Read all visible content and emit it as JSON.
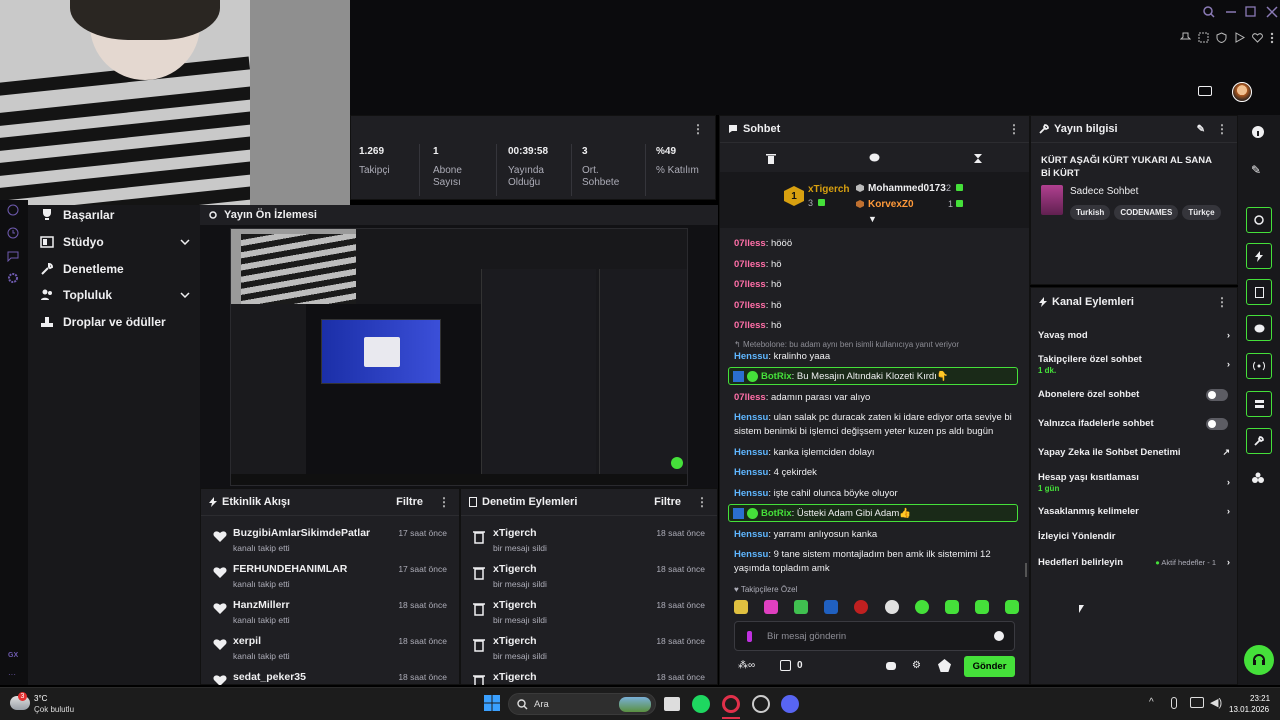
{
  "stats": [
    {
      "value": "1.269",
      "label": "Takipçi"
    },
    {
      "value": "1",
      "label": "Abone Sayısı"
    },
    {
      "value": "00:39:58",
      "label": "Yayında Olduğu"
    },
    {
      "value": "3",
      "label": "Ort. Sohbete"
    },
    {
      "value": "%49",
      "label": "% Katılım"
    }
  ],
  "nav": {
    "items": [
      {
        "label": "Başarılar"
      },
      {
        "label": "Stüdyo"
      },
      {
        "label": "Denetleme"
      },
      {
        "label": "Topluluk"
      },
      {
        "label": "Droplar ve ödüller"
      }
    ],
    "bottom_tag": "GX"
  },
  "preview": {
    "title": "Yayın Ön İzlemesi"
  },
  "activity": {
    "title": "Etkinlik Akışı",
    "filter": "Filtre",
    "rows": [
      {
        "name": "BuzgibiAmlarSikimdePatlar",
        "sub": "kanalı takip etti",
        "time": "17 saat önce"
      },
      {
        "name": "FERHUNDEHANIMLAR",
        "sub": "kanalı takip etti",
        "time": "17 saat önce"
      },
      {
        "name": "HanzMillerr",
        "sub": "kanalı takip etti",
        "time": "18 saat önce"
      },
      {
        "name": "xerpil",
        "sub": "kanalı takip etti",
        "time": "18 saat önce"
      },
      {
        "name": "sedat_peker35",
        "sub": "",
        "time": "18 saat önce"
      }
    ]
  },
  "moderation": {
    "title": "Denetim Eylemleri",
    "filter": "Filtre",
    "rows": [
      {
        "name": "xTigerch",
        "sub": "bir mesajı sildi",
        "time": "18 saat önce"
      },
      {
        "name": "xTigerch",
        "sub": "bir mesajı sildi",
        "time": "18 saat önce"
      },
      {
        "name": "xTigerch",
        "sub": "bir mesajı sildi",
        "time": "18 saat önce"
      },
      {
        "name": "xTigerch",
        "sub": "bir mesajı sildi",
        "time": "18 saat önce"
      },
      {
        "name": "xTigerch",
        "sub": "",
        "time": "18 saat önce"
      }
    ]
  },
  "chat": {
    "title": "Sohbet",
    "leaderboard": {
      "first": {
        "name": "xTigerch",
        "count": "3"
      },
      "others": [
        {
          "name": "Mohammed0173",
          "count": "2"
        },
        {
          "name": "KorvexZ0",
          "count": "1"
        }
      ]
    },
    "reply_note": "Metebolone: bu adam aynı ben isimli kullanıcıya yanıt veriyor",
    "messages": [
      {
        "user": "07lless",
        "text": "hööö",
        "color": "#ff6fa8"
      },
      {
        "user": "07lless",
        "text": "hö",
        "color": "#ff6fa8"
      },
      {
        "user": "07lless",
        "text": "hö",
        "color": "#ff6fa8"
      },
      {
        "user": "07lless",
        "text": "hö",
        "color": "#ff6fa8"
      },
      {
        "user": "07lless",
        "text": "hö",
        "color": "#ff6fa8"
      },
      {
        "user": "Henssu",
        "text": "kralinho yaaa",
        "color": "#5fb6ff"
      },
      {
        "user": "BotRix",
        "text": "Bu Mesajın Altındaki Klozeti Kırdı👇",
        "color": "#45e03a",
        "bot": true
      },
      {
        "user": "07lless",
        "text": "adamın parası var alıyo",
        "color": "#ff6fa8"
      },
      {
        "user": "Henssu",
        "text": "ulan salak pc duracak zaten ki idare ediyor orta seviye bi sistem benimki bi işlemci değişsem yeter kuzen ps aldı bugün",
        "color": "#5fb6ff"
      },
      {
        "user": "Henssu",
        "text": "kanka işlemciden dolayı",
        "color": "#5fb6ff"
      },
      {
        "user": "Henssu",
        "text": "4 çekirdek",
        "color": "#5fb6ff"
      },
      {
        "user": "Henssu",
        "text": "işte cahil olunca böyke oluyor",
        "color": "#5fb6ff"
      },
      {
        "user": "BotRix",
        "text": "Üstteki Adam Gibi Adam👍",
        "color": "#45e03a",
        "bot": true
      },
      {
        "user": "Henssu",
        "text": "yarramı anlıyosun kanka",
        "color": "#5fb6ff"
      },
      {
        "user": "Henssu",
        "text": "9 tane sistem montajladım ben amk ilk sistemimi 12 yaşımda topladım amk",
        "color": "#5fb6ff"
      }
    ],
    "followers_only": "Takipçilere Özel",
    "input_placeholder": "Bir mesaj gönderin",
    "points": "0",
    "send_label": "Gönder"
  },
  "info": {
    "title": "Yayın bilgisi",
    "stream_title": "KÜRT AŞAĞI KÜRT YUKARI AL SANA Bİ KÜRT",
    "category": "Sadece Sohbet",
    "tags": [
      "Turkish",
      "CODENAMES",
      "Türkçe"
    ]
  },
  "actions": {
    "title": "Kanal Eylemleri",
    "items": [
      {
        "label": "Yavaş mod",
        "sub": "",
        "kind": "chev"
      },
      {
        "label": "Takipçilere özel sohbet",
        "sub": "1 dk.",
        "kind": "chev"
      },
      {
        "label": "Abonelere özel sohbet",
        "sub": "",
        "kind": "toggle"
      },
      {
        "label": "Yalnızca ifadelerle sohbet",
        "sub": "",
        "kind": "toggle"
      },
      {
        "label": "Yapay Zeka ile Sohbet Denetimi",
        "sub": "",
        "kind": "ext"
      },
      {
        "label": "Hesap yaşı kısıtlaması",
        "sub": "1 gün",
        "kind": "chev"
      },
      {
        "label": "Yasaklanmış kelimeler",
        "sub": "",
        "kind": "chev"
      },
      {
        "label": "İzleyici Yönlendir",
        "sub": "",
        "kind": "none"
      },
      {
        "label": "Hedefleri belirleyin",
        "sub": "",
        "kind": "chev",
        "status": "Aktif hedefler - 1"
      }
    ]
  },
  "taskbar": {
    "weather_temp": "3°C",
    "weather_desc": "Çok bulutlu",
    "search_label": "Ara",
    "time": "23:21",
    "date": "13.01.2026",
    "badge": "3"
  },
  "colors": {
    "accent": "#45e03a",
    "panel": "#1f1f23",
    "bg": "#18181b"
  }
}
